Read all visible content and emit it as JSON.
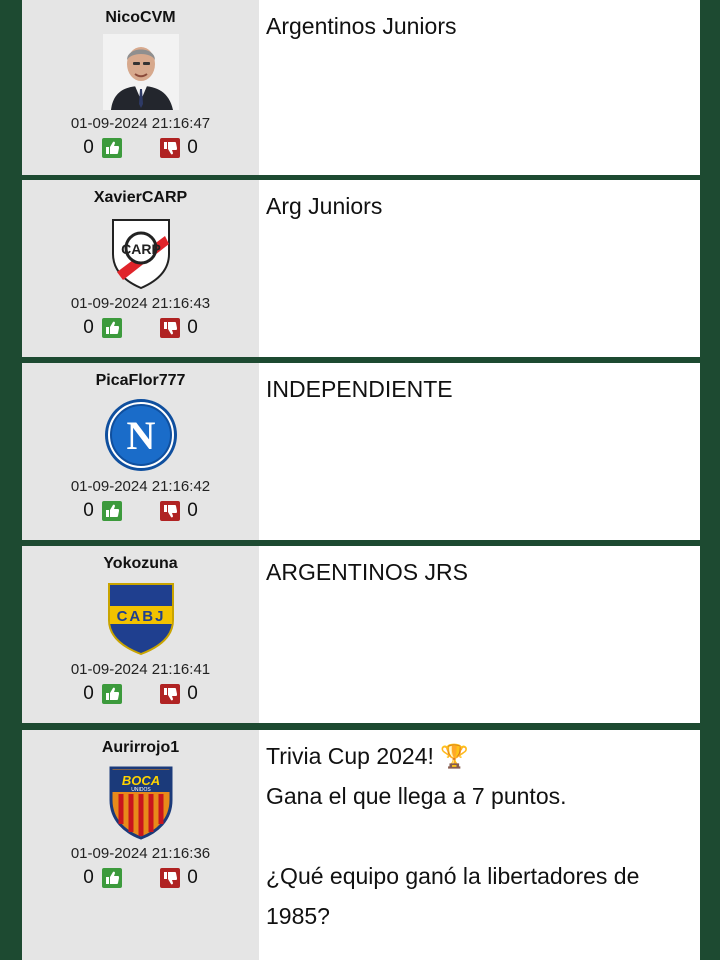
{
  "posts": [
    {
      "username": "NicoCVM",
      "avatar": "person-photo-avatar",
      "timestamp": "01-09-2024 21:16:47",
      "likes": "0",
      "dislikes": "0",
      "message": "Argentinos Juniors"
    },
    {
      "username": "XavierCARP",
      "avatar": "river-plate-crest",
      "timestamp": "01-09-2024 21:16:43",
      "likes": "0",
      "dislikes": "0",
      "message": "Arg Juniors"
    },
    {
      "username": "PicaFlor777",
      "avatar": "napoli-crest",
      "timestamp": "01-09-2024 21:16:42",
      "likes": "0",
      "dislikes": "0",
      "message": "INDEPENDIENTE"
    },
    {
      "username": "Yokozuna",
      "avatar": "boca-juniors-crest",
      "timestamp": "01-09-2024 21:16:41",
      "likes": "0",
      "dislikes": "0",
      "message": "ARGENTINOS JRS"
    },
    {
      "username": "Aurirrojo1",
      "avatar": "boca-unidos-crest",
      "timestamp": "01-09-2024 21:16:36",
      "likes": "0",
      "dislikes": "0",
      "message_lines": [
        "Trivia Cup 2024! 🏆",
        "Gana el que llega a 7 puntos.",
        "",
        "¿Qué equipo ganó la libertadores de",
        "1985?"
      ]
    }
  ],
  "icons": {
    "like": "thumbs-up-icon",
    "dislike": "thumbs-down-icon"
  },
  "colors": {
    "background": "#1d4a31",
    "sidebar": "#e5e5e5",
    "like": "#3c9a3c",
    "dislike": "#b02323"
  }
}
